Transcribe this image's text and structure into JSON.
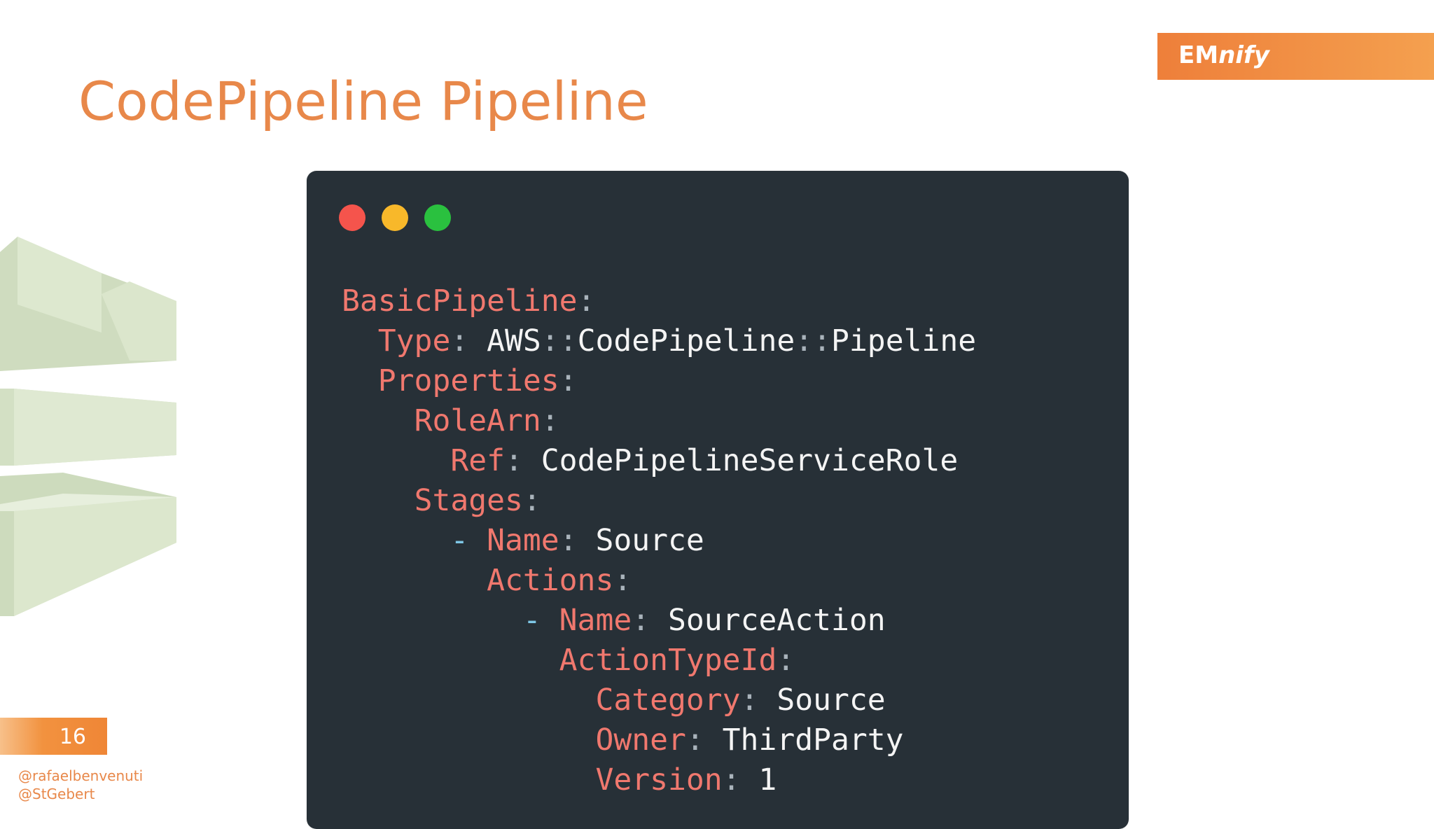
{
  "slide": {
    "title": "CodePipeline Pipeline",
    "page_number": "16",
    "handles": [
      "@rafaelbenvenuti",
      "@StGebert"
    ]
  },
  "brand": {
    "part1": "EM",
    "part2": "nify",
    "color": "#ef8636"
  },
  "window_controls": {
    "close_color": "#f5544c",
    "minimize_color": "#f8b82a",
    "maximize_color": "#2ac13f"
  },
  "code": {
    "key_color": "#f0786e",
    "value_color": "#f4f4f4",
    "lines": [
      {
        "indent": "",
        "dash": "",
        "key": "BasicPipeline",
        "sep": ":",
        "value": ""
      },
      {
        "indent": "  ",
        "dash": "",
        "key": "Type",
        "sep": ":",
        "value": " AWS::CodePipeline::Pipeline"
      },
      {
        "indent": "  ",
        "dash": "",
        "key": "Properties",
        "sep": ":",
        "value": ""
      },
      {
        "indent": "    ",
        "dash": "",
        "key": "RoleArn",
        "sep": ":",
        "value": ""
      },
      {
        "indent": "      ",
        "dash": "",
        "key": "Ref",
        "sep": ":",
        "value": " CodePipelineServiceRole"
      },
      {
        "indent": "    ",
        "dash": "",
        "key": "Stages",
        "sep": ":",
        "value": ""
      },
      {
        "indent": "      ",
        "dash": "- ",
        "key": "Name",
        "sep": ":",
        "value": " Source"
      },
      {
        "indent": "        ",
        "dash": "",
        "key": "Actions",
        "sep": ":",
        "value": ""
      },
      {
        "indent": "          ",
        "dash": "- ",
        "key": "Name",
        "sep": ":",
        "value": " SourceAction"
      },
      {
        "indent": "            ",
        "dash": "",
        "key": "ActionTypeId",
        "sep": ":",
        "value": ""
      },
      {
        "indent": "              ",
        "dash": "",
        "key": "Category",
        "sep": ":",
        "value": " Source"
      },
      {
        "indent": "              ",
        "dash": "",
        "key": "Owner",
        "sep": ":",
        "value": " ThirdParty"
      },
      {
        "indent": "              ",
        "dash": "",
        "key": "Version",
        "sep": ":",
        "value": " 1"
      }
    ]
  }
}
